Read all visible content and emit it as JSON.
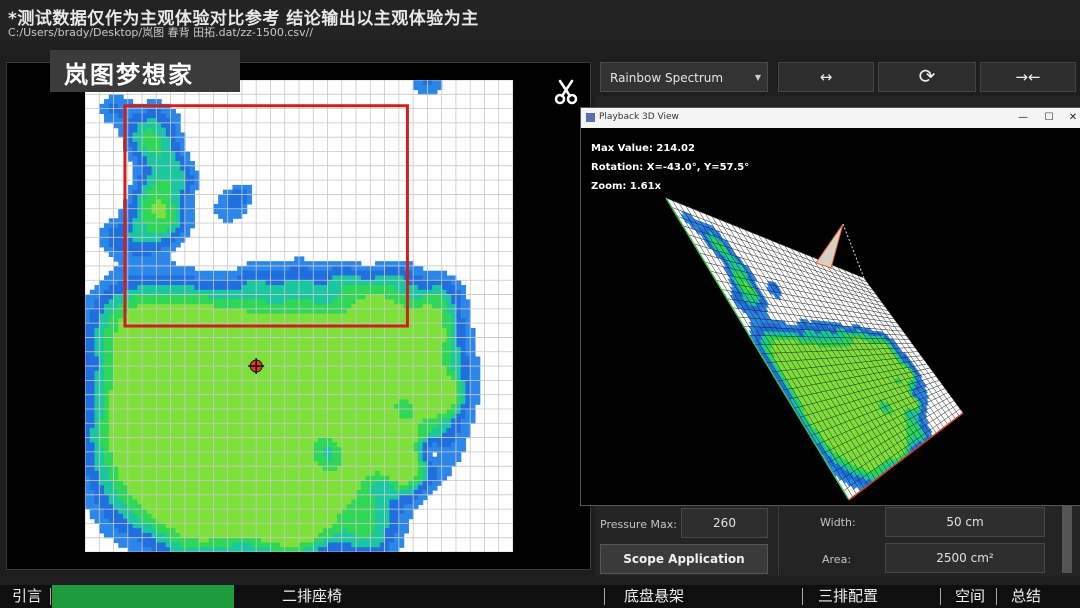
{
  "overlay": {
    "disclaimer": "*测试数据仅作为主观体验对比参考 结论输出以主观体验为主",
    "brand": "岚图梦想家"
  },
  "file_path": "C:/Users/brady/Desktop/岚图 春背 田拓.dat/zz-1500.csv//",
  "toolbar": {
    "color_scheme": "Rainbow Spectrum",
    "expand_symbol": "↔",
    "rotate_symbol": "⟳",
    "compress_symbol": "→←"
  },
  "playback_window": {
    "title": "Playback 3D View",
    "max_value": "Max Value: 214.02",
    "rotation": "Rotation: X=-43.0°, Y=57.5°",
    "zoom": "Zoom: 1.61x",
    "controls": {
      "minimize": "—",
      "maximize": "☐",
      "close": "✕"
    }
  },
  "pressure_max": {
    "label": "Pressure Max:",
    "value": "260"
  },
  "scope_button": "Scope Application",
  "dimensions": {
    "width_label": "Width:",
    "width_value": "50 cm",
    "area_label": "Area:",
    "area_value": "2500 cm²"
  },
  "chapters": {
    "progress_fraction": 0.217,
    "items": [
      {
        "label": "引言"
      },
      {
        "label": "二排座椅"
      },
      {
        "label": "底盘悬架"
      },
      {
        "label": "三排配置"
      },
      {
        "label": "空间"
      },
      {
        "label": "总结"
      }
    ]
  },
  "colors": {
    "grid_line": "#c8c8c8",
    "selection_rect": "#d01f1f",
    "pressure_low": "#1e7ee8",
    "pressure_mid": "#22d35a",
    "pressure_high": "#e63c2e",
    "progress": "#1e9b3d"
  },
  "icons": {
    "cut": "scissors-icon",
    "marker": "center-of-pressure-icon"
  },
  "heatmap_data": {
    "cols": 30,
    "rows": 33,
    "blobs": [
      [
        5,
        3,
        1.3,
        0.6
      ],
      [
        4,
        4,
        1.0,
        0.5
      ],
      [
        5,
        5,
        1.2,
        0.6
      ],
      [
        6,
        6,
        1.0,
        0.5
      ],
      [
        5,
        8,
        1.1,
        0.7
      ],
      [
        5,
        9,
        1.4,
        0.75
      ],
      [
        6,
        10,
        1.0,
        0.6
      ],
      [
        4,
        11,
        1.2,
        0.6
      ],
      [
        2,
        11,
        0.9,
        0.5
      ],
      [
        10,
        9,
        0.9,
        0.5
      ],
      [
        7,
        7,
        0.8,
        0.45
      ],
      [
        12,
        14,
        1.0,
        0.55
      ],
      [
        15,
        14,
        1.2,
        0.6
      ],
      [
        18,
        14,
        1.0,
        0.6
      ],
      [
        20,
        15,
        1.2,
        0.7
      ],
      [
        22,
        14,
        1.1,
        0.6
      ],
      [
        25,
        15,
        1.2,
        0.65
      ],
      [
        21,
        17,
        1.2,
        0.65
      ],
      [
        24,
        17,
        1.3,
        0.7
      ],
      [
        3,
        17,
        2.2,
        1.0
      ],
      [
        6,
        17,
        2.2,
        1.0
      ],
      [
        9,
        17,
        2.0,
        0.9
      ],
      [
        12,
        18,
        2.0,
        0.95
      ],
      [
        15,
        18,
        2.1,
        0.95
      ],
      [
        18,
        18,
        2.1,
        0.95
      ],
      [
        21,
        18,
        1.9,
        0.9
      ],
      [
        24,
        18,
        1.8,
        0.85
      ],
      [
        4,
        21,
        2.5,
        1.0
      ],
      [
        8,
        21,
        2.5,
        1.0
      ],
      [
        12,
        21,
        2.5,
        1.0
      ],
      [
        16,
        21,
        2.5,
        1.0
      ],
      [
        20,
        21,
        2.4,
        1.0
      ],
      [
        24,
        21,
        2.2,
        0.95
      ],
      [
        3,
        25,
        2.5,
        1.0
      ],
      [
        8,
        25,
        2.6,
        1.0
      ],
      [
        13,
        25,
        2.5,
        1.0
      ],
      [
        18,
        25,
        2.5,
        1.0
      ],
      [
        23,
        25,
        2.3,
        0.95
      ],
      [
        4,
        29,
        2.4,
        1.0
      ],
      [
        9,
        29,
        2.5,
        1.0
      ],
      [
        14,
        29,
        2.5,
        1.0
      ],
      [
        19,
        29,
        2.3,
        0.95
      ],
      [
        8,
        31.5,
        2.0,
        0.9
      ],
      [
        14,
        31.5,
        2.0,
        0.9
      ],
      [
        20,
        32,
        1.4,
        0.7
      ],
      [
        5,
        21,
        1.6,
        1.9
      ],
      [
        7,
        23,
        1.5,
        1.9
      ],
      [
        5,
        25,
        1.6,
        1.8
      ],
      [
        7,
        28,
        1.6,
        1.8
      ],
      [
        11,
        29,
        1.5,
        1.8
      ],
      [
        15,
        30,
        1.4,
        1.7
      ],
      [
        13,
        26,
        1.2,
        1.6
      ],
      [
        20,
        24,
        1.3,
        1.7
      ],
      [
        22,
        27,
        1.2,
        1.6
      ],
      [
        9,
        20,
        1.2,
        1.5
      ],
      [
        14,
        22,
        1.0,
        1.5
      ],
      [
        25,
        22,
        0.9,
        1.4
      ],
      [
        2,
        2,
        0.9,
        0.55
      ],
      [
        24,
        0,
        0.9,
        0.6
      ],
      [
        11,
        8,
        0.7,
        0.5
      ]
    ],
    "holes": [
      [
        7,
        19,
        0.9
      ],
      [
        10,
        20,
        0.8
      ],
      [
        15,
        20,
        0.9
      ],
      [
        19,
        20,
        0.8
      ],
      [
        13,
        22,
        0.9
      ],
      [
        22,
        23,
        0.8
      ],
      [
        9,
        25,
        0.9
      ],
      [
        17,
        26,
        1.0
      ],
      [
        12,
        28,
        0.9
      ],
      [
        21,
        28,
        0.8
      ],
      [
        6,
        27,
        0.7
      ],
      [
        24,
        26,
        0.7
      ]
    ],
    "marker": [
      12,
      20
    ],
    "selection": {
      "col0": 2.8,
      "row0": 1.8,
      "col1": 22.6,
      "row1": 17.2
    }
  }
}
